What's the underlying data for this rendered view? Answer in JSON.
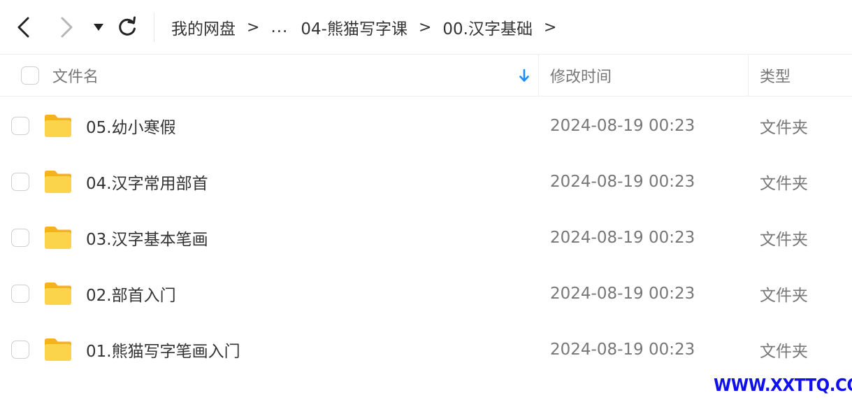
{
  "breadcrumb": {
    "root": "我的网盘",
    "ellipsis": "...",
    "parent": "04-熊猫写字课",
    "current": "00.汉字基础",
    "separator": ">"
  },
  "table": {
    "header": {
      "name": "文件名",
      "modified": "修改时间",
      "type": "类型"
    },
    "rows": [
      {
        "name": "05.幼小寒假",
        "modified": "2024-08-19 00:23",
        "type": "文件夹"
      },
      {
        "name": "04.汉字常用部首",
        "modified": "2024-08-19 00:23",
        "type": "文件夹"
      },
      {
        "name": "03.汉字基本笔画",
        "modified": "2024-08-19 00:23",
        "type": "文件夹"
      },
      {
        "name": "02.部首入门",
        "modified": "2024-08-19 00:23",
        "type": "文件夹"
      },
      {
        "name": "01.熊猫写字笔画入门",
        "modified": "2024-08-19 00:23",
        "type": "文件夹"
      }
    ]
  },
  "icons": {
    "back": "chevron-left-icon",
    "forward": "chevron-right-icon",
    "history": "caret-down-icon",
    "refresh": "refresh-icon",
    "sort": "sort-arrow-down-icon",
    "folder": "folder-icon"
  },
  "colors": {
    "accent": "#1a8cff",
    "folder": "#f9c937",
    "watermark": "#1010ee"
  },
  "watermark": "WWW.XXTTQ.COM"
}
